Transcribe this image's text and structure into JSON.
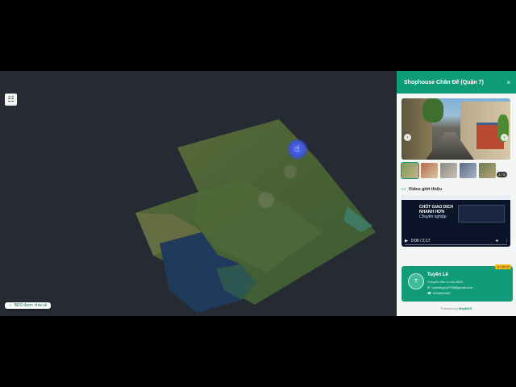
{
  "map": {
    "share_label": "BĐS được chia sẻ",
    "menu_icon": "grid-icon",
    "cursor_icon": "hand-pointer-icon"
  },
  "panel": {
    "title": "Shophouse Chân Đế (Quận 7)",
    "close_icon": "×",
    "accent": "#0f9c78",
    "gallery": {
      "count": "1 / 5",
      "prev_icon": "‹",
      "next_icon": "›"
    },
    "video": {
      "heading": "Video giới thiệu",
      "title_line1": "CHỐT GIAO DỊCH",
      "title_line2": "NHANH HƠN",
      "subtitle": "Chuyên nghiệp",
      "time": "0:00 / 2:17"
    },
    "contact": {
      "initial": "T",
      "name": "Tuyền Lê",
      "role": "Chuyên viên tư vấn BĐS",
      "email": "tuyenlegeo2708@gmail.com",
      "phone": "0938524467",
      "badge": "★ Liên hệ"
    },
    "powered_prefix": "Powered by ",
    "powered_brand": "MapBDS"
  }
}
